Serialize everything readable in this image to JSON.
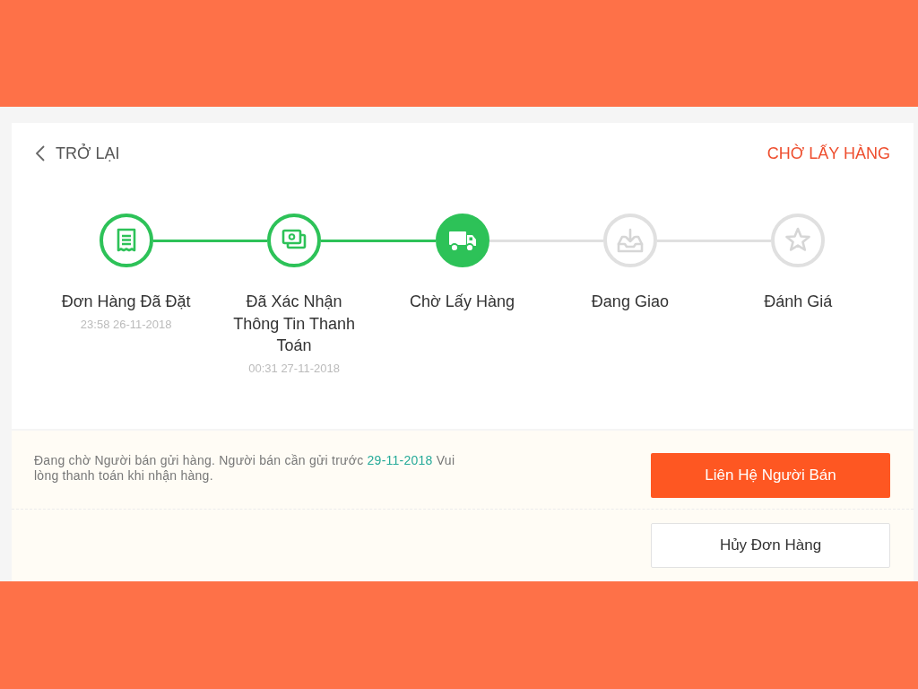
{
  "header": {
    "back_label": "TRỞ LẠI",
    "status": "CHỜ LẤY HÀNG"
  },
  "steps": [
    {
      "label": "Đơn Hàng Đã Đặt",
      "time": "23:58 26-11-2018",
      "reached": true,
      "current": false
    },
    {
      "label": "Đã Xác Nhận Thông Tin Thanh Toán",
      "time": "00:31 27-11-2018",
      "reached": true,
      "current": false
    },
    {
      "label": "Chờ Lấy Hàng",
      "reached": true,
      "current": true
    },
    {
      "label": "Đang Giao",
      "reached": false,
      "current": false
    },
    {
      "label": "Đánh Giá",
      "reached": false,
      "current": false
    }
  ],
  "notice": {
    "text_before": "Đang chờ Người bán gửi hàng. Người bán cần gửi trước ",
    "highlight": "29-11-2018",
    "text_after": " Vui lòng thanh toán khi nhận hàng."
  },
  "buttons": [
    {
      "label": "Liên Hệ Người Bán",
      "kind": "primary"
    },
    {
      "label": "Hủy Đơn Hàng",
      "kind": "secondary"
    }
  ]
}
